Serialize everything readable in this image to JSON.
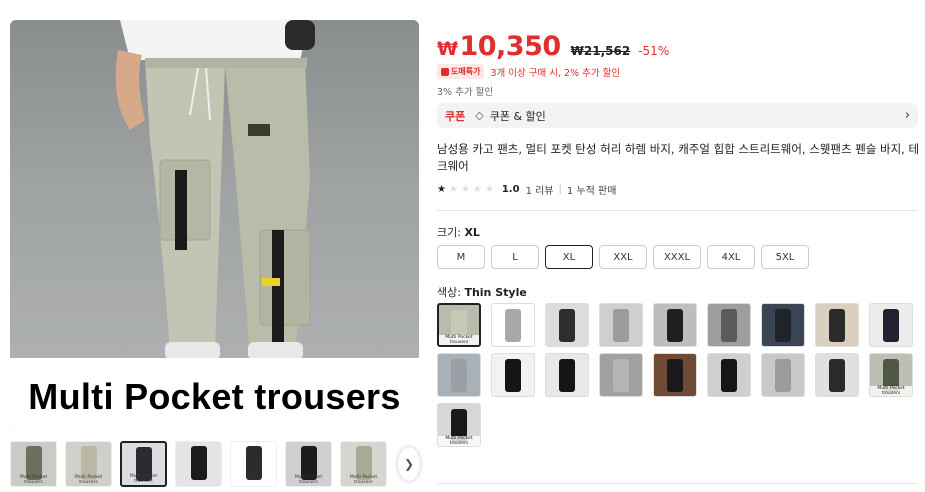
{
  "gallery": {
    "main_caption": "Multi Pocket trousers",
    "thumbnails": [
      {
        "label": "Multi Pocket trousers",
        "bg": "#c9ccc4",
        "pant": "#6b6f5e"
      },
      {
        "label": "Multi Pocket trousers",
        "bg": "#cfd0cc",
        "pant": "#b9b9a6"
      },
      {
        "label": "Multi Pocket trousers",
        "bg": "#dcdde0",
        "pant": "#2a2a33"
      },
      {
        "label": "",
        "bg": "#e4e4e4",
        "pant": "#1b1b1b"
      },
      {
        "label": "",
        "bg": "#ffffff",
        "pant": "#2c2c2c"
      },
      {
        "label": "Multi Pocket trousers",
        "bg": "#d0d0d0",
        "pant": "#1d1d1d"
      },
      {
        "label": "Multi Pocket trousers",
        "bg": "#d6d6d0",
        "pant": "#a9aa94"
      }
    ],
    "next_icon": "chevron-right-icon"
  },
  "price": {
    "current": "10,350",
    "currency_symbol": "₩",
    "original": "₩21,562",
    "discount": "-51%"
  },
  "promo": {
    "badge": "도매특가",
    "text": "3개 이상 구매 시, 2% 추가 할인"
  },
  "extra_discount": "3% 추가 할인",
  "coupon": {
    "label": "쿠폰",
    "text": "쿠폰 & 할인"
  },
  "title": "남성용 카고 팬츠, 멀티 포켓 탄성 허리 하렘 바지, 캐주얼 힙합 스트리트웨어, 스웻팬츠 펜슬 바지, 테크웨어",
  "rating": {
    "score": "1.0",
    "stars_filled": 1,
    "stars_total": 5,
    "reviews": "1 리뷰",
    "sold": "1 누적 판매"
  },
  "size": {
    "label": "크기: ",
    "selected": "XL",
    "options": [
      "M",
      "L",
      "XL",
      "XXL",
      "XXXL",
      "4XL",
      "5XL"
    ]
  },
  "color": {
    "label": "색상: ",
    "selected": "Thin Style",
    "options": [
      {
        "label": "Multi Pocket trousers",
        "bg": "#b9bcad",
        "pant": "#c7c9b6"
      },
      {
        "label": "",
        "bg": "#ffffff",
        "pant": "#a9a9a9"
      },
      {
        "label": "",
        "bg": "#dcdcdc",
        "pant": "#2d2d2d"
      },
      {
        "label": "",
        "bg": "#cfcfcf",
        "pant": "#9b9b9b"
      },
      {
        "label": "",
        "bg": "#bdbdbd",
        "pant": "#1f1f1f"
      },
      {
        "label": "",
        "bg": "#9e9e9e",
        "pant": "#5b5b5b"
      },
      {
        "label": "",
        "bg": "#3a4452",
        "pant": "#20242a"
      },
      {
        "label": "",
        "bg": "#d9d0bf",
        "pant": "#2b2b2b"
      },
      {
        "label": "",
        "bg": "#ececec",
        "pant": "#222233"
      },
      {
        "label": "",
        "bg": "#a7b1b7",
        "pant": "#9aa0a6"
      },
      {
        "label": "",
        "bg": "#f2f2f2",
        "pant": "#141414"
      },
      {
        "label": "",
        "bg": "#e8e8e8",
        "pant": "#151515"
      },
      {
        "label": "",
        "bg": "#9fa39f",
        "pant": "#b5b5b5"
      },
      {
        "label": "",
        "bg": "#6f4b36",
        "pant": "#1a1a1a"
      },
      {
        "label": "",
        "bg": "#cfcfcf",
        "pant": "#161616"
      },
      {
        "label": "",
        "bg": "#c8c8c8",
        "pant": "#9b9b9b"
      },
      {
        "label": "",
        "bg": "#e0e0e0",
        "pant": "#2a2a2a"
      },
      {
        "label": "Multi Pocket trousers",
        "bg": "#bcbfb2",
        "pant": "#4f5746"
      },
      {
        "label": "Multi Pocket trousers",
        "bg": "#d7d7d7",
        "pant": "#1a1a1a"
      }
    ]
  },
  "colors_theme": {
    "accent_red": "#e02d2d"
  }
}
